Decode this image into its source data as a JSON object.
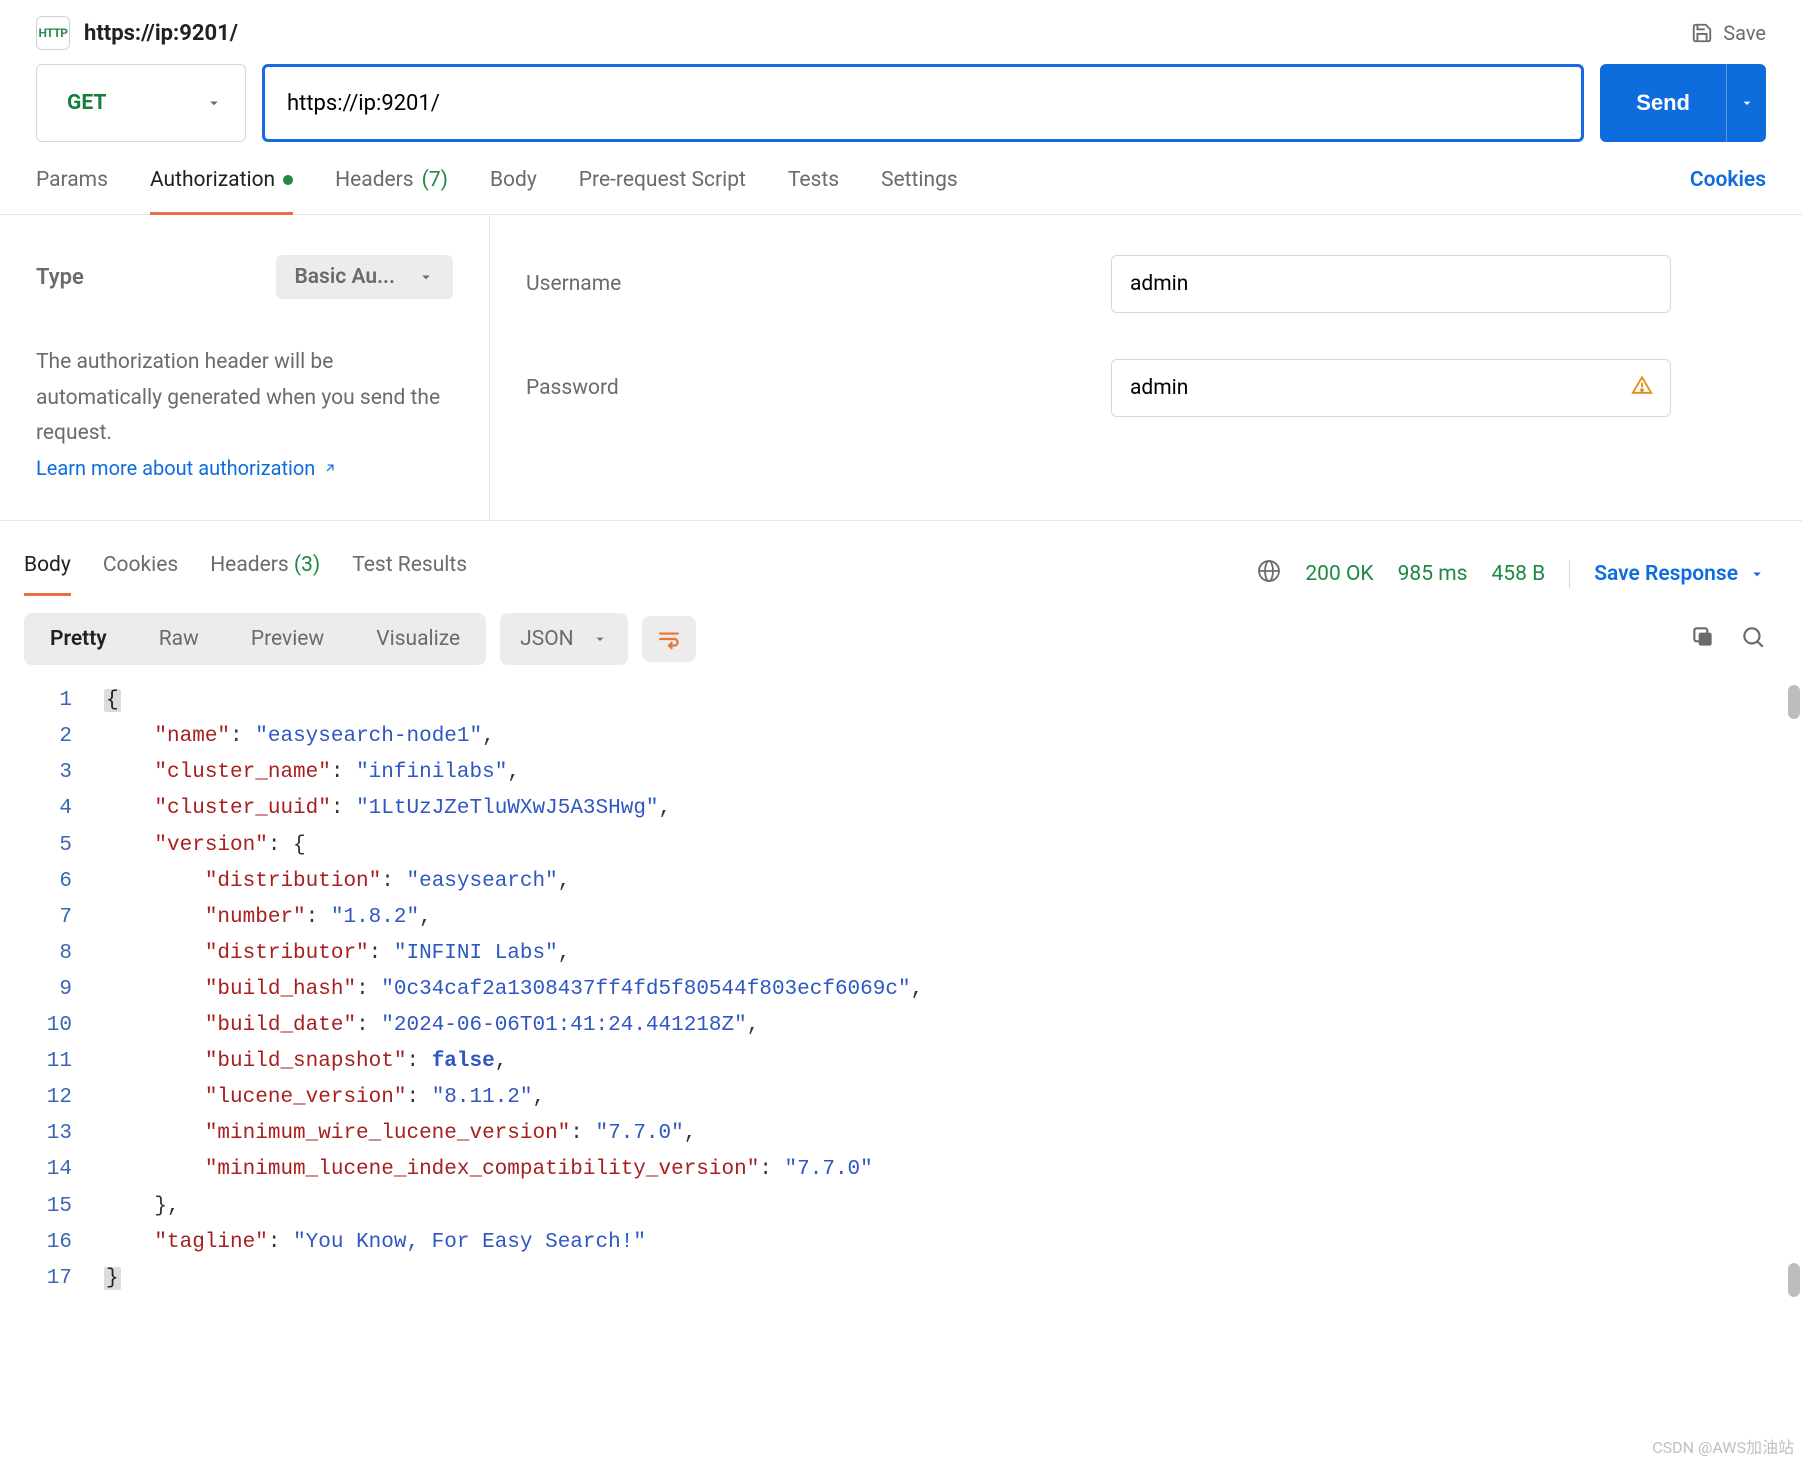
{
  "header": {
    "icon_label": "HTTP",
    "title": "https://ip:9201/",
    "save_label": "Save"
  },
  "request": {
    "method": "GET",
    "url": "https://ip:9201/",
    "send_label": "Send"
  },
  "req_tabs": {
    "params": "Params",
    "auth": "Authorization",
    "headers": "Headers",
    "headers_count": "(7)",
    "body": "Body",
    "prereq": "Pre-request Script",
    "tests": "Tests",
    "settings": "Settings",
    "cookies": "Cookies"
  },
  "auth": {
    "type_label": "Type",
    "type_value": "Basic Au...",
    "info_text": "The authorization header will be automatically generated when you send the request.",
    "learn_label": "Learn more about authorization",
    "username_label": "Username",
    "username_value": "admin",
    "password_label": "Password",
    "password_value": "admin"
  },
  "resp_tabs": {
    "body": "Body",
    "cookies": "Cookies",
    "headers": "Headers",
    "headers_count": "(3)",
    "test_results": "Test Results"
  },
  "status": {
    "code": "200 OK",
    "time": "985 ms",
    "size": "458 B",
    "save_response": "Save Response"
  },
  "views": {
    "pretty": "Pretty",
    "raw": "Raw",
    "preview": "Preview",
    "visualize": "Visualize",
    "format": "JSON"
  },
  "response_body": {
    "name": "easysearch-node1",
    "cluster_name": "infinilabs",
    "cluster_uuid": "1LtUzJZeTluWXwJ5A3SHwg",
    "version": {
      "distribution": "easysearch",
      "number": "1.8.2",
      "distributor": "INFINI Labs",
      "build_hash": "0c34caf2a1308437ff4fd5f80544f803ecf6069c",
      "build_date": "2024-06-06T01:41:24.441218Z",
      "build_snapshot": "false",
      "lucene_version": "8.11.2",
      "minimum_wire_lucene_version": "7.7.0",
      "minimum_lucene_index_compatibility_version": "7.7.0"
    },
    "tagline": "You Know, For Easy Search!"
  },
  "line_numbers": [
    "1",
    "2",
    "3",
    "4",
    "5",
    "6",
    "7",
    "8",
    "9",
    "10",
    "11",
    "12",
    "13",
    "14",
    "15",
    "16",
    "17"
  ],
  "watermark": "CSDN @AWS加油站"
}
